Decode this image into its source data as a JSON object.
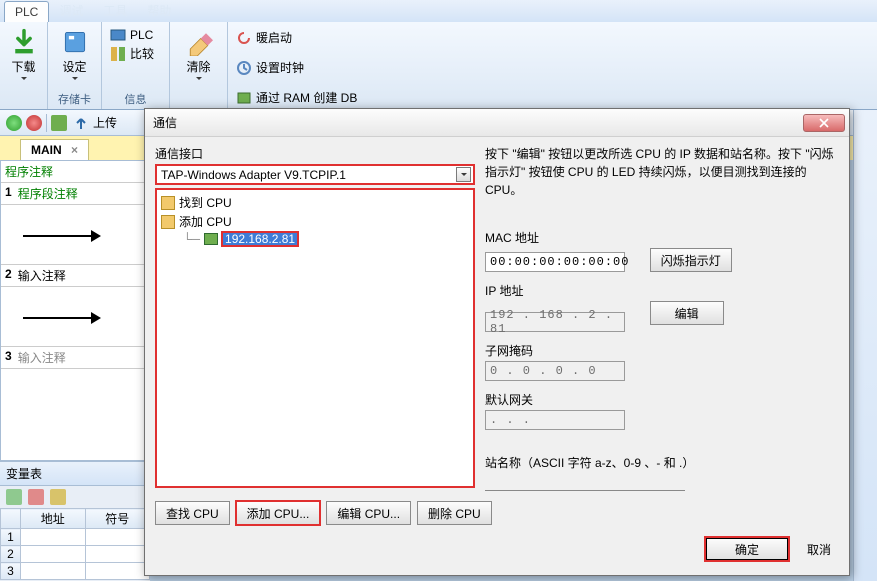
{
  "menubar": {
    "active_tab": "PLC",
    "items": [
      "调试",
      "工具",
      "帮助"
    ]
  },
  "ribbon": {
    "group1": {
      "download": "下载",
      "caption": ""
    },
    "group2": {
      "setup": "设定",
      "caption": "存储卡"
    },
    "group3": {
      "plc": "PLC",
      "compare": "比较",
      "caption": "信息"
    },
    "group4": {
      "clear": "清除",
      "warm_start": "暖启动",
      "set_clock": "设置时钟",
      "create_db": "通过 RAM 创建 DB",
      "caption": ""
    }
  },
  "sec_toolbar": {
    "upload_label": "上传"
  },
  "tabstrip": {
    "main_tab": "MAIN"
  },
  "editor": {
    "program_comment": "程序注释",
    "segment_comment": "程序段注释",
    "input_comment": "输入注释",
    "row3_comment": "输入注释"
  },
  "var_table": {
    "title": "变量表",
    "col_addr": "地址",
    "col_sym": "符号",
    "rows": [
      "1",
      "2",
      "3"
    ]
  },
  "dialog": {
    "title": "通信",
    "iface_label": "通信接口",
    "iface_value": "TAP-Windows Adapter V9.TCPIP.1",
    "tree": {
      "find_cpu": "找到 CPU",
      "add_cpu": "添加 CPU",
      "ip_node": "192.168.2.81"
    },
    "desc": "按下 \"编辑\" 按钮以更改所选 CPU 的 IP 数据和站名称。按下 \"闪烁指示灯\" 按钮使 CPU 的 LED 持续闪烁，以便目测找到连接的 CPU。",
    "mac_label": "MAC 地址",
    "mac_value": "00:00:00:00:00:00",
    "flash_btn": "闪烁指示灯",
    "ip_label": "IP 地址",
    "ip_value": "192 . 168 .  2  . 81",
    "edit_btn": "编辑",
    "subnet_label": "子网掩码",
    "subnet_value": " 0  .  0  .  0  .  0",
    "gateway_label": "默认网关",
    "gateway_value": " .    .    .  ",
    "station_label": "站名称（ASCII 字符 a-z、0-9 、- 和 .）",
    "btn_find": "查找 CPU",
    "btn_add": "添加 CPU...",
    "btn_editcpu": "编辑 CPU...",
    "btn_delete": "删除 CPU",
    "btn_ok": "确定",
    "btn_cancel": "取消"
  }
}
